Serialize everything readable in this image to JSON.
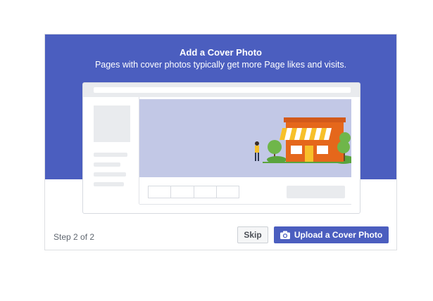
{
  "dialog": {
    "title": "Add a Cover Photo",
    "subtitle": "Pages with cover photos typically get more Page likes and visits."
  },
  "footer": {
    "step_text": "Step 2 of 2",
    "skip_label": "Skip",
    "upload_label": "Upload a Cover Photo",
    "upload_icon": "camera-icon"
  },
  "colors": {
    "brand_blue": "#4b5ebf",
    "cover_placeholder": "#c2c8e6",
    "illustration_orange": "#e5671b",
    "awning_yellow": "#f7c02a",
    "tree_green": "#6fb64a"
  }
}
